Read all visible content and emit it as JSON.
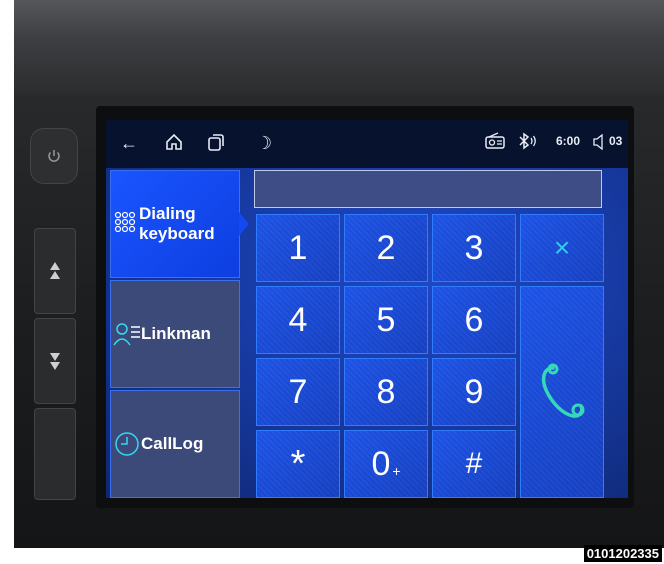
{
  "status_bar": {
    "back_icon": "←",
    "home_icon": "⌂",
    "recents_icon": "⧉",
    "night_icon": "☽",
    "radio_icon": "radio",
    "bluetooth_icon": "✱",
    "time": "6:00",
    "volume_icon": "◁",
    "volume_level": "03"
  },
  "sidebar": {
    "items": [
      {
        "label_line1": "Dialing",
        "label_line2": "keyboard",
        "icon": "keypad-icon",
        "active": true
      },
      {
        "label": "Linkman",
        "icon": "contacts-icon",
        "active": false
      },
      {
        "label": "CallLog",
        "icon": "clock-icon",
        "active": false
      }
    ]
  },
  "number_display": {
    "value": ""
  },
  "keypad": {
    "keys": [
      "1",
      "2",
      "3",
      "4",
      "5",
      "6",
      "7",
      "8",
      "9",
      "*",
      "0",
      "#"
    ],
    "zero_sub": "+",
    "delete_label": "×"
  },
  "colors": {
    "accent": "#1a55ff",
    "call_icon": "#35d9b6"
  },
  "photo_label": "0101202335"
}
